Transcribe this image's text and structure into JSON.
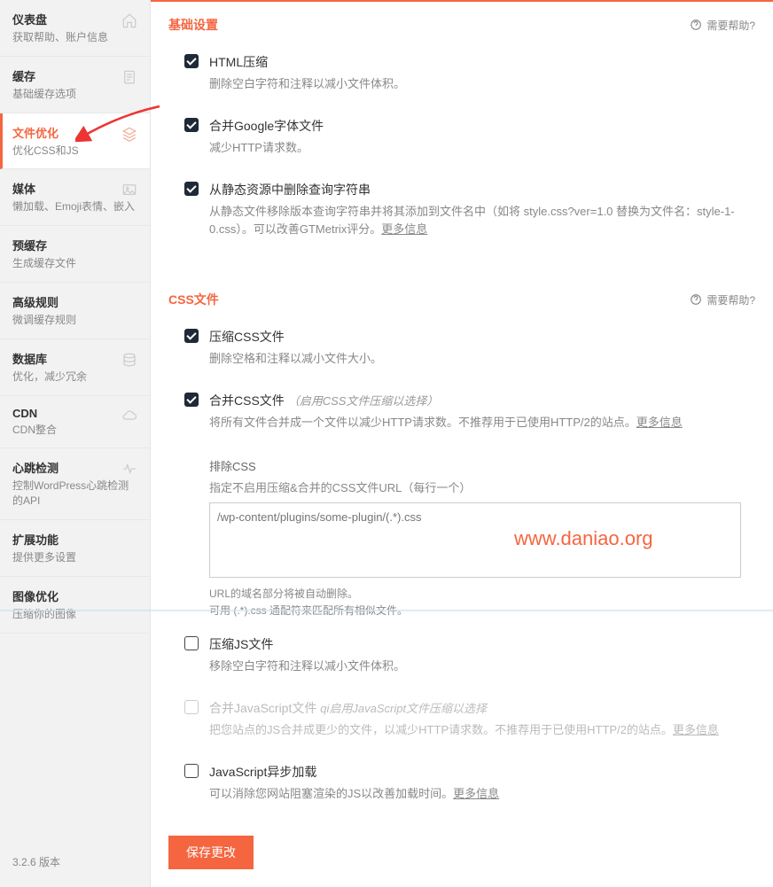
{
  "sidebar": {
    "items": [
      {
        "title": "仪表盘",
        "sub": "获取帮助、账户信息",
        "icon": "home"
      },
      {
        "title": "缓存",
        "sub": "基础缓存选项",
        "icon": "doc"
      },
      {
        "title": "文件优化",
        "sub": "优化CSS和JS",
        "icon": "layers",
        "active": true
      },
      {
        "title": "媒体",
        "sub": "懒加载、Emoji表情、嵌入",
        "icon": "image"
      },
      {
        "title": "预缓存",
        "sub": "生成缓存文件",
        "icon": ""
      },
      {
        "title": "高级规则",
        "sub": "微调缓存规则",
        "icon": ""
      },
      {
        "title": "数据库",
        "sub": "优化，减少冗余",
        "icon": "db"
      },
      {
        "title": "CDN",
        "sub": "CDN整合",
        "icon": "cloud"
      },
      {
        "title": "心跳检测",
        "sub": "控制WordPress心跳检测的API",
        "icon": "heart"
      },
      {
        "title": "扩展功能",
        "sub": "提供更多设置",
        "icon": ""
      },
      {
        "title": "图像优化",
        "sub": "压缩你的图像",
        "icon": ""
      }
    ],
    "version": "3.2.6 版本"
  },
  "help_label": "需要帮助?",
  "sections": {
    "basic": {
      "title": "基础设置",
      "opts": [
        {
          "checked": true,
          "title": "HTML压缩",
          "desc": "删除空白字符和注释以减小文件体积。"
        },
        {
          "checked": true,
          "title": "合并Google字体文件",
          "desc": "减少HTTP请求数。"
        },
        {
          "checked": true,
          "title": "从静态资源中删除查询字符串",
          "desc": "从静态文件移除版本查询字符串并将其添加到文件名中（如将 style.css?ver=1.0 替换为文件名：style-1-0.css）。可以改善GTMetrix评分。",
          "link": "更多信息"
        }
      ]
    },
    "css": {
      "title": "CSS文件",
      "opts": [
        {
          "checked": true,
          "title": "压缩CSS文件",
          "desc": "删除空格和注释以减小文件大小。"
        },
        {
          "checked": true,
          "title": "合并CSS文件",
          "italic": "（启用CSS文件压缩以选择）",
          "desc": "将所有文件合并成一个文件以减少HTTP请求数。不推荐用于已使用HTTP/2的站点。",
          "link": "更多信息"
        }
      ],
      "exclude": {
        "label": "排除CSS",
        "hint": "指定不启用压缩&合并的CSS文件URL（每行一个）",
        "placeholder": "/wp-content/plugins/some-plugin/(.*).css",
        "below1": "URL的域名部分将被自动删除。",
        "below2": "可用 (.*).css 通配符来匹配所有相似文件。"
      },
      "js": [
        {
          "checked": false,
          "title": "压缩JS文件",
          "desc": "移除空白字符和注释以减小文件体积。"
        },
        {
          "checked": false,
          "dim": true,
          "title": "合并JavaScript文件",
          "italic": "qi启用JavaScript文件压缩以选择",
          "desc": "把您站点的JS合并成更少的文件，以减少HTTP请求数。不推荐用于已使用HTTP/2的站点。",
          "link": "更多信息"
        },
        {
          "checked": false,
          "title": "JavaScript异步加载",
          "desc": "可以消除您网站阻塞渲染的JS以改善加载时间。",
          "link": "更多信息"
        }
      ]
    }
  },
  "save_label": "保存更改",
  "watermark": "www.daniao.org",
  "colors": {
    "accent": "#f56640"
  }
}
